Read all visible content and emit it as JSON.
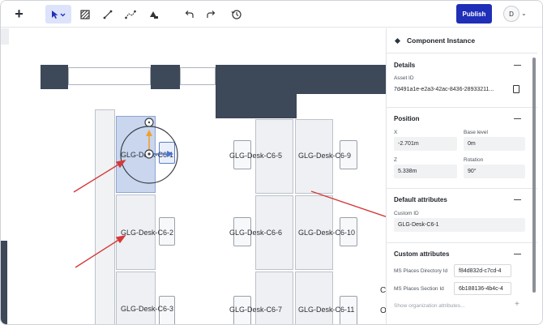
{
  "toolbar": {
    "add_icon": "plus-icon",
    "tools": [
      "select-arrow-icon",
      "hatch-area-icon",
      "line-tool-icon",
      "polyline-tool-icon",
      "fill-tool-icon",
      "undo-icon",
      "redo-icon",
      "history-icon"
    ],
    "publish_label": "Publish",
    "avatar_initial": "D"
  },
  "canvas": {
    "desks": [
      {
        "label": "GLG-Desk-C6-1",
        "selected": true
      },
      {
        "label": "GLG-Desk-C6-2"
      },
      {
        "label": "GLG-Desk-C6-3"
      },
      {
        "label": "GLG-Desk-C6-5"
      },
      {
        "label": "GLG-Desk-C6-6"
      },
      {
        "label": "GLG-Desk-C6-7"
      },
      {
        "label": "GLG-Desk-C6-9"
      },
      {
        "label": "GLG-Desk-C6-10"
      },
      {
        "label": "GLG-Desk-C6-11"
      }
    ],
    "edge_letters": [
      "C",
      "O"
    ]
  },
  "panel": {
    "title": "Component Instance",
    "details": {
      "title": "Details",
      "asset_id_label": "Asset ID",
      "asset_id_value": "7d491a1e-e2a3-42ac-8436-28933211..."
    },
    "position": {
      "title": "Position",
      "x_label": "X",
      "x_value": "-2.701m",
      "base_level_label": "Base level",
      "base_level_value": "0m",
      "z_label": "Z",
      "z_value": "5.338m",
      "rotation_label": "Rotation",
      "rotation_value": "90°"
    },
    "default_attributes": {
      "title": "Default attributes",
      "custom_id_label": "Custom ID",
      "custom_id_value": "GLG-Desk-C6-1"
    },
    "custom_attributes": {
      "title": "Custom attributes",
      "rows": [
        {
          "label": "MS Places Directory Id",
          "value": "f84d832d-c7cd-4"
        },
        {
          "label": "MS Places Section Id",
          "value": "6b188136-4b4c-4"
        }
      ],
      "show_more": "Show organization attributes..."
    }
  },
  "colors": {
    "accent": "#1f2fb8",
    "wall": "#3d4859",
    "selection": "#c9d6ee",
    "annotation_arrow": "#d6393a"
  }
}
